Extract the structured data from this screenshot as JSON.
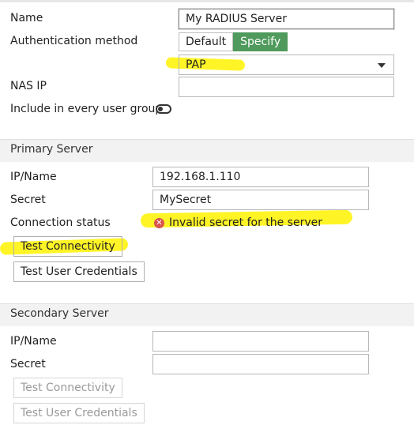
{
  "general": {
    "name_label": "Name",
    "name_value": "My RADIUS Server",
    "auth_label": "Authentication method",
    "auth_options": [
      "Default",
      "Specify"
    ],
    "auth_selected": "Specify",
    "auth_protocol": "PAP",
    "nas_ip_label": "NAS IP",
    "nas_ip_value": "",
    "include_label": "Include in every user group",
    "include_enabled": false
  },
  "primary": {
    "section_title": "Primary Server",
    "ip_label": "IP/Name",
    "ip_value": "192.168.1.110",
    "secret_label": "Secret",
    "secret_value": "MySecret",
    "status_label": "Connection status",
    "status_text": "Invalid secret for the server",
    "test_connectivity": "Test Connectivity",
    "test_credentials": "Test User Credentials"
  },
  "secondary": {
    "section_title": "Secondary Server",
    "ip_label": "IP/Name",
    "ip_value": "",
    "secret_label": "Secret",
    "secret_value": "",
    "test_connectivity": "Test Connectivity",
    "test_credentials": "Test User Credentials"
  },
  "colors": {
    "accent_green": "#4f9a5c",
    "error_red": "#d9534f",
    "highlight": "#fff200"
  },
  "icons": {
    "status": "error-x-icon",
    "dropdown": "chevron-down-icon"
  }
}
